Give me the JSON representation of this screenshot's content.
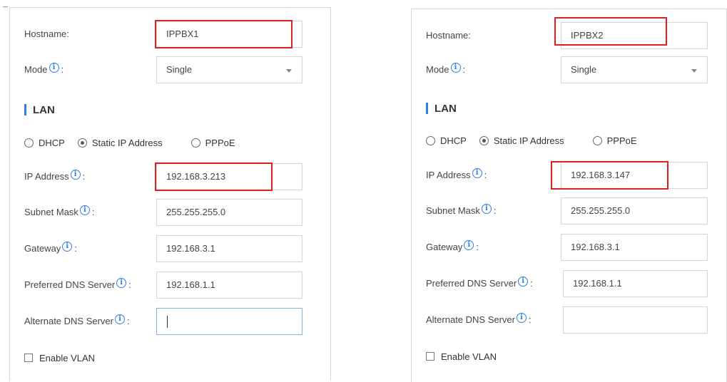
{
  "panels": [
    {
      "hostname_label": "Hostname:",
      "hostname_value": "IPPBX1",
      "mode_label": "Mode",
      "mode_value": "Single",
      "section_title": "LAN",
      "radio_options": [
        "DHCP",
        "Static IP Address",
        "PPPoE"
      ],
      "radio_selected": "Static IP Address",
      "ip_label": "IP Address",
      "ip_value": "192.168.3.213",
      "subnet_label": "Subnet Mask",
      "subnet_value": "255.255.255.0",
      "gateway_label": "Gateway",
      "gateway_value": "192.168.3.1",
      "pref_dns_label": "Preferred DNS Server",
      "pref_dns_value": "192.168.1.1",
      "alt_dns_label": "Alternate DNS Server",
      "alt_dns_value": "",
      "vlan_label": "Enable VLAN"
    },
    {
      "hostname_label": "Hostname:",
      "hostname_value": "IPPBX2",
      "mode_label": "Mode",
      "mode_value": "Single",
      "section_title": "LAN",
      "radio_options": [
        "DHCP",
        "Static IP Address",
        "PPPoE"
      ],
      "radio_selected": "Static IP Address",
      "ip_label": "IP Address",
      "ip_value": "192.168.3.147",
      "subnet_label": "Subnet Mask",
      "subnet_value": "255.255.255.0",
      "gateway_label": "Gateway",
      "gateway_value": "192.168.3.1",
      "pref_dns_label": "Preferred DNS Server",
      "pref_dns_value": "192.168.1.1",
      "alt_dns_label": "Alternate DNS Server",
      "alt_dns_value": "",
      "vlan_label": "Enable VLAN"
    }
  ],
  "info_icon_glyph": "i",
  "colon": ":",
  "colors": {
    "accent": "#2d7fe0",
    "highlight": "#e02020",
    "border": "#d5d5d5"
  }
}
